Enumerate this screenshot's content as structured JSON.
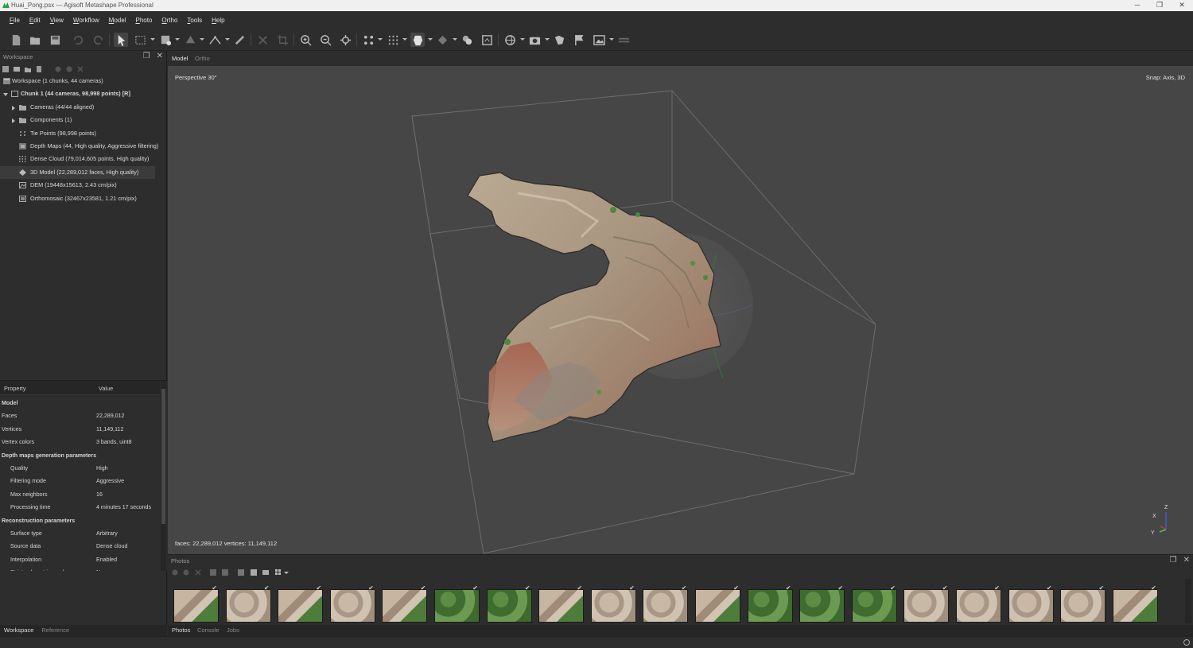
{
  "window": {
    "title": "Huai_Pong.psx — Agisoft Metashape Professional",
    "controls": [
      "─",
      "❐",
      "✕"
    ]
  },
  "menu": [
    "File",
    "Edit",
    "View",
    "Workflow",
    "Model",
    "Photo",
    "Ortho",
    "Tools",
    "Help"
  ],
  "toolbar": {
    "icons": [
      "new-icon",
      "open-icon",
      "save-icon",
      "undo-icon",
      "redo-icon",
      "navigation-icon",
      "rectangle-selection-icon",
      "resize-region-icon",
      "rotate-region-icon",
      "ruler-icon",
      "draw-polyline-icon",
      "delete-icon",
      "crop-icon",
      "zoom-in-icon",
      "zoom-out-icon",
      "reset-view-icon",
      "show-tie-points-icon",
      "show-dense-cloud-icon",
      "show-model-icon",
      "show-dem-icon",
      "show-cameras-icon",
      "show-region-icon",
      "view-mode-icon",
      "capture-view-icon",
      "show-markers-icon",
      "show-shapes-icon",
      "show-images-icon",
      "show-aligned-icon"
    ]
  },
  "workspace": {
    "title": "Workspace",
    "tree": [
      {
        "label": "Workspace (1 chunks, 44 cameras)",
        "icon": "workspace-icon",
        "level": 0,
        "bold": false
      },
      {
        "label": "Chunk 1 (44 cameras, 98,998 points) [R]",
        "icon": "chunk-icon",
        "level": 0,
        "bold": true,
        "expanded": true
      },
      {
        "label": "Cameras (44/44 aligned)",
        "icon": "folder-icon",
        "level": 1,
        "collapsed": true
      },
      {
        "label": "Components (1)",
        "icon": "folder-icon",
        "level": 1,
        "collapsed": true
      },
      {
        "label": "Tie Points (98,998 points)",
        "icon": "tie-points-icon",
        "level": 1
      },
      {
        "label": "Depth Maps (44, High quality, Aggressive filtering)",
        "icon": "depth-maps-icon",
        "level": 1
      },
      {
        "label": "Dense Cloud (79,014,605 points, High quality)",
        "icon": "dense-cloud-icon",
        "level": 1
      },
      {
        "label": "3D Model (22,289,012 faces, High quality)",
        "icon": "model-icon",
        "level": 1,
        "selected": true
      },
      {
        "label": "DEM (19448x15613, 2.43 cm/pix)",
        "icon": "dem-icon",
        "level": 1
      },
      {
        "label": "Orthomosaic (32467x23581, 1.21 cm/pix)",
        "icon": "orthomosaic-icon",
        "level": 1
      }
    ]
  },
  "properties": {
    "col_property": "Property",
    "col_value": "Value",
    "rows": [
      {
        "k": "Model",
        "v": "",
        "section": true
      },
      {
        "k": "Faces",
        "v": "22,289,012"
      },
      {
        "k": "Vertices",
        "v": "11,149,112"
      },
      {
        "k": "Vertex colors",
        "v": "3 bands, uint8"
      },
      {
        "k": "Depth maps generation parameters",
        "v": "",
        "section": true
      },
      {
        "k": "Quality",
        "v": "High",
        "indent": true
      },
      {
        "k": "Filtering mode",
        "v": "Aggressive",
        "indent": true
      },
      {
        "k": "Max neighbors",
        "v": "16",
        "indent": true
      },
      {
        "k": "Processing time",
        "v": "4 minutes 17 seconds",
        "indent": true
      },
      {
        "k": "Reconstruction parameters",
        "v": "",
        "section": true
      },
      {
        "k": "Surface type",
        "v": "Arbitrary",
        "indent": true
      },
      {
        "k": "Source data",
        "v": "Dense cloud",
        "indent": true
      },
      {
        "k": "Interpolation",
        "v": "Enabled",
        "indent": true
      },
      {
        "k": "Strict volumetric masks",
        "v": "No",
        "indent": true
      }
    ]
  },
  "left_tabs": [
    "Workspace",
    "Reference"
  ],
  "view_tabs": [
    "Model",
    "Ortho"
  ],
  "viewport": {
    "perspective": "Perspective 30°",
    "snap": "Snap: Axis, 3D",
    "stats": "faces: 22,289,012 vertices: 11,149,112",
    "axes": {
      "x": "X",
      "y": "Y",
      "z": "Z"
    }
  },
  "photos": {
    "title": "Photos",
    "thumbnails": [
      "forest-rock",
      "rock",
      "forest-rock",
      "rock",
      "forest-rock",
      "forest",
      "forest",
      "forest-rock",
      "rock",
      "rock",
      "forest-rock",
      "forest",
      "forest",
      "forest",
      "rock",
      "rock",
      "rock",
      "rock",
      "forest-rock"
    ]
  },
  "bottom_tabs": [
    "Photos",
    "Console",
    "Jobs"
  ],
  "colors": {
    "viewport_bg": "#464646",
    "panel_bg": "#2d2d2d",
    "region_box": "#6a6a6a"
  }
}
